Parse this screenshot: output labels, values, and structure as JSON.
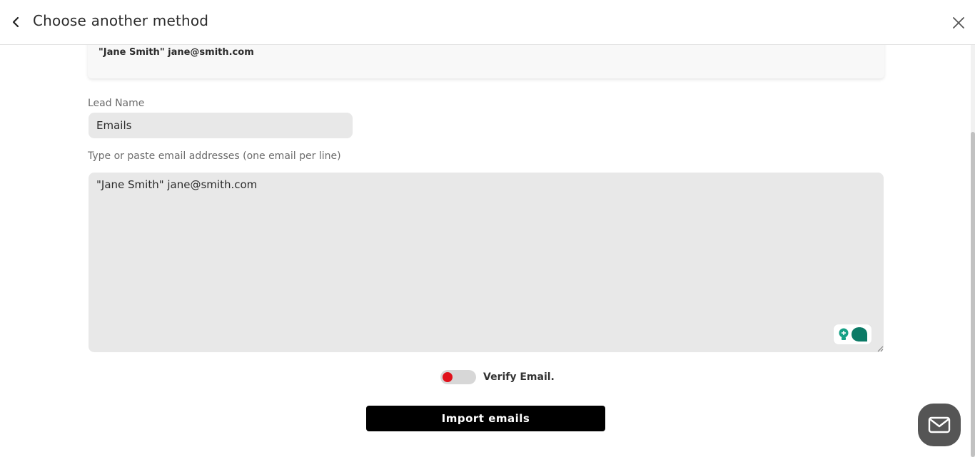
{
  "header": {
    "title": "Choose another method",
    "back_icon": "chevron-left-icon",
    "close_icon": "close-icon"
  },
  "example": {
    "text": "\"Jane Smith\" jane@smith.com"
  },
  "form": {
    "lead_name_label": "Lead Name",
    "lead_name_value": "Emails",
    "emails_label": "Type or paste email addresses (one email per line)",
    "emails_value": "\"Jane Smith\" jane@smith.com",
    "verify_label": "Verify Email.",
    "verify_enabled": false,
    "import_button": "Import emails"
  },
  "colors": {
    "toggle_knob": "#e0111b",
    "primary_button": "#000000",
    "assist_badge": "#0b7a66"
  },
  "widgets": {
    "assist_icon": "grammar-assistant-icon",
    "chat_icon": "mail-icon"
  }
}
